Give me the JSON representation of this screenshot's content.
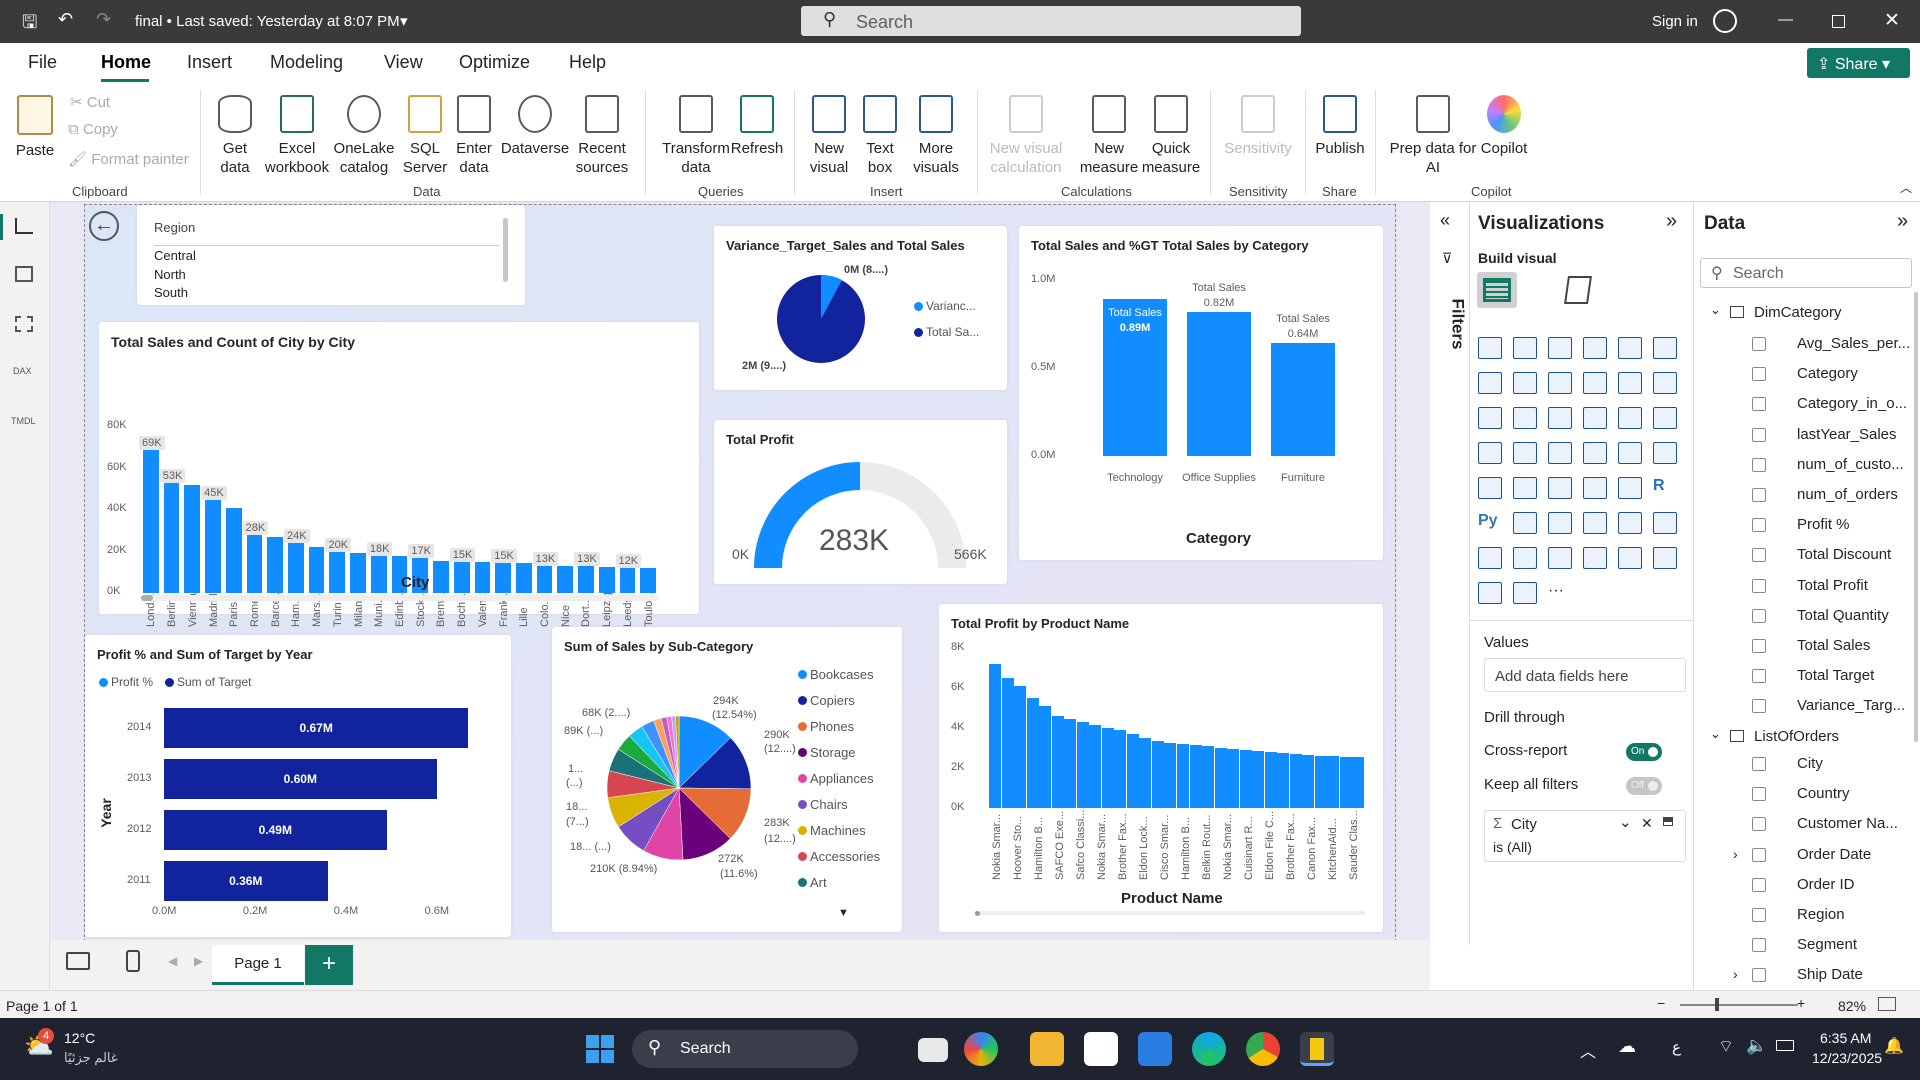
{
  "titlebar": {
    "doc": "final • Last saved: Yesterday at 8:07 PM",
    "search": "Search",
    "signin": "Sign in"
  },
  "menu": {
    "tabs": [
      "File",
      "Home",
      "Insert",
      "Modeling",
      "View",
      "Optimize",
      "Help"
    ],
    "share": "Share"
  },
  "ribbon": {
    "clipboard": {
      "paste": "Paste",
      "cut": "Cut",
      "copy": "Copy",
      "format": "Format painter",
      "group": "Clipboard"
    },
    "data": {
      "items": [
        "Get data",
        "Excel workbook",
        "OneLake catalog",
        "SQL Server",
        "Enter data",
        "Dataverse",
        "Recent sources"
      ],
      "group": "Data"
    },
    "queries": {
      "items": [
        "Transform data",
        "Refresh"
      ],
      "group": "Queries"
    },
    "insert": {
      "items": [
        "New visual",
        "Text box",
        "More visuals"
      ],
      "group": "Insert"
    },
    "calc": {
      "items": [
        "New visual calculation",
        "New measure",
        "Quick measure"
      ],
      "group": "Calculations"
    },
    "sensitivity": {
      "items": [
        "Sensitivity"
      ],
      "group": "Sensitivity"
    },
    "share": {
      "items": [
        "Publish"
      ],
      "group": "Share"
    },
    "copilot": {
      "items": [
        "Prep data for AI",
        "Copilot"
      ],
      "group": "Copilot"
    }
  },
  "slicer": {
    "title": "Region",
    "items": [
      "Central",
      "North",
      "South"
    ]
  },
  "city_chart": {
    "title": "Total Sales and Count of City by City",
    "xlabel": "City",
    "yticks": [
      "80K",
      "60K",
      "40K",
      "20K",
      "0K"
    ],
    "chart_data": {
      "type": "bar",
      "ylim": [
        0,
        80000
      ],
      "categories": [
        "Lond...",
        "Berlin",
        "Vienna",
        "Madrid",
        "Paris",
        "Rome",
        "Barce...",
        "Ham...",
        "Mars...",
        "Turin",
        "Milan",
        "Muni...",
        "Edinb...",
        "Stock...",
        "Brem...",
        "Boch...",
        "Valen...",
        "Frank...",
        "Lille",
        "Colo...",
        "Nice",
        "Dort...",
        "Leipzig",
        "Leeds",
        "Toulo..."
      ],
      "values": [
        69000,
        53000,
        52000,
        45000,
        41000,
        28000,
        27000,
        24000,
        22000,
        20000,
        19500,
        18000,
        18000,
        17000,
        15500,
        15000,
        15000,
        14500,
        14500,
        13000,
        13000,
        13000,
        12500,
        12000,
        12000
      ],
      "data_labels": {
        "0": "69K",
        "1": "53K",
        "3": "45K",
        "5": "28K",
        "7": "24K",
        "9": "20K",
        "11": "18K",
        "13": "17K",
        "15": "15K",
        "17": "15K",
        "19": "13K",
        "21": "13K",
        "23": "12K"
      }
    }
  },
  "variance": {
    "title": "Variance_Target_Sales and Total Sales",
    "lbl_top": "0M (8....)",
    "lbl_bottom": "2M (9....)",
    "legend": [
      "Varianc...",
      "Total Sa..."
    ],
    "chart_data": {
      "type": "pie",
      "labels": [
        "Variance_Target_Sales",
        "Total Sales"
      ],
      "values": [
        0.08,
        0.92
      ]
    }
  },
  "profit_gauge": {
    "title": "Total Profit",
    "value": "283K",
    "min": "0K",
    "max": "566K",
    "chart_data": {
      "type": "gauge",
      "value": 283000,
      "min": 0,
      "max": 566000
    }
  },
  "category_chart": {
    "title": "Total Sales and %GT Total Sales by Category",
    "xlabel": "Category",
    "yticks": [
      "1.0M",
      "0.5M",
      "0.0M"
    ],
    "chart_data": {
      "type": "bar",
      "ylim": [
        0,
        1000000
      ],
      "categories": [
        "Technology",
        "Office Supplies",
        "Furniture"
      ],
      "values": [
        890000,
        820000,
        640000
      ],
      "labels": [
        [
          "Total Sales",
          "0.89M"
        ],
        [
          "Total Sales",
          "0.82M"
        ],
        [
          "Total Sales",
          "0.64M"
        ]
      ]
    }
  },
  "year_chart": {
    "title": "Profit % and Sum of Target by Year",
    "legend": [
      "Profit %",
      "Sum of Target"
    ],
    "ylabel": "Year",
    "xticks": [
      "0.0M",
      "0.2M",
      "0.4M",
      "0.6M"
    ],
    "chart_data": {
      "type": "bar",
      "orientation": "horizontal",
      "xlim": [
        0,
        0.7
      ],
      "categories": [
        "2014",
        "2013",
        "2012",
        "2011"
      ],
      "values": [
        0.67,
        0.6,
        0.49,
        0.36
      ],
      "labels": [
        "0.67M",
        "0.60M",
        "0.49M",
        "0.36M"
      ]
    }
  },
  "subcat_chart": {
    "title": "Sum of Sales by Sub-Category",
    "legend": [
      {
        "name": "Bookcases",
        "color": "#118dff"
      },
      {
        "name": "Copiers",
        "color": "#12239e"
      },
      {
        "name": "Phones",
        "color": "#e66c37"
      },
      {
        "name": "Storage",
        "color": "#6b007b"
      },
      {
        "name": "Appliances",
        "color": "#e044a7"
      },
      {
        "name": "Chairs",
        "color": "#744ec2"
      },
      {
        "name": "Machines",
        "color": "#d9b300"
      },
      {
        "name": "Accessories",
        "color": "#d64550"
      },
      {
        "name": "Art",
        "color": "#197278"
      }
    ],
    "labels": [
      "294K",
      "(12.54%)",
      "290K",
      "(12....)",
      "283K",
      "(12....)",
      "272K",
      "(11.6%)",
      "210K (8.94%)",
      "68K (2....)",
      "89K (...)",
      "1...",
      "(...)",
      "18...",
      "(7...)",
      "18... (...)"
    ],
    "chart_data": {
      "type": "pie",
      "values": [
        294000,
        290000,
        283000,
        272000,
        210000,
        180000,
        160000,
        140000,
        120000,
        89000,
        80000,
        68000,
        40000,
        30000,
        25000,
        20000,
        18000
      ]
    }
  },
  "product_chart": {
    "title": "Total Profit by Product Name",
    "xlabel": "Product Name",
    "yticks": [
      "8K",
      "6K",
      "4K",
      "2K",
      "0K"
    ],
    "categories": [
      "Nokia Smar...",
      "Hoover Sto...",
      "Hamilton B...",
      "SAFCO Exe...",
      "Safco Classi...",
      "Nokia Smar...",
      "Brother Fax...",
      "Eldon Lock...",
      "Cisco Smar...",
      "Hamilton B...",
      "Belkin Rout...",
      "Nokia Smar...",
      "Cuisinart R...",
      "Eldon File C...",
      "Brother Fax...",
      "Canon Fax...",
      "KitchenAid...",
      "Sauder Clas..."
    ],
    "chart_data": {
      "type": "bar",
      "ylim": [
        0,
        8000
      ],
      "values": [
        7200,
        6500,
        6100,
        5500,
        5100,
        4600,
        4450,
        4300,
        4150,
        4000,
        3900,
        3700,
        3500,
        3350,
        3250,
        3200,
        3150,
        3100,
        3000,
        2950,
        2900,
        2850,
        2800,
        2750,
        2700,
        2650,
        2600,
        2600,
        2550,
        2550
      ]
    }
  },
  "pages": {
    "tab": "Page 1",
    "status": "Page 1 of 1",
    "zoom": "82%"
  },
  "filters": {
    "label": "Filters"
  },
  "viz": {
    "title": "Visualizations",
    "build": "Build visual",
    "values": "Values",
    "add": "Add data fields here",
    "drill": "Drill through",
    "cross": "Cross-report",
    "cross_state": "On",
    "keep": "Keep all filters",
    "keep_state": "Off",
    "filter_field": "City",
    "filter_state": "is (All)"
  },
  "datapanel": {
    "title": "Data",
    "search": "Search",
    "dimcategory": "DimCategory",
    "dim_fields": [
      "Avg_Sales_per...",
      "Category",
      "Category_in_o...",
      "lastYear_Sales",
      "num_of_custo...",
      "num_of_orders",
      "Profit %",
      "Total Discount",
      "Total Profit",
      "Total Quantity",
      "Total Sales",
      "Total Target",
      "Variance_Targ..."
    ],
    "listoforders": "ListOfOrders",
    "order_fields": [
      "City",
      "Country",
      "Customer Na...",
      "Order Date",
      "Order ID",
      "Region",
      "Segment",
      "Ship Date"
    ]
  },
  "taskbar": {
    "temp": "12°C",
    "weather": "غالم جزئيًا",
    "search": "Search",
    "time": "6:35 AM",
    "date": "12/23/2025",
    "badge": "4",
    "lang": "ع"
  },
  "colors": {
    "accent": "#118dff",
    "dark": "#12239e",
    "share": "#117865"
  }
}
